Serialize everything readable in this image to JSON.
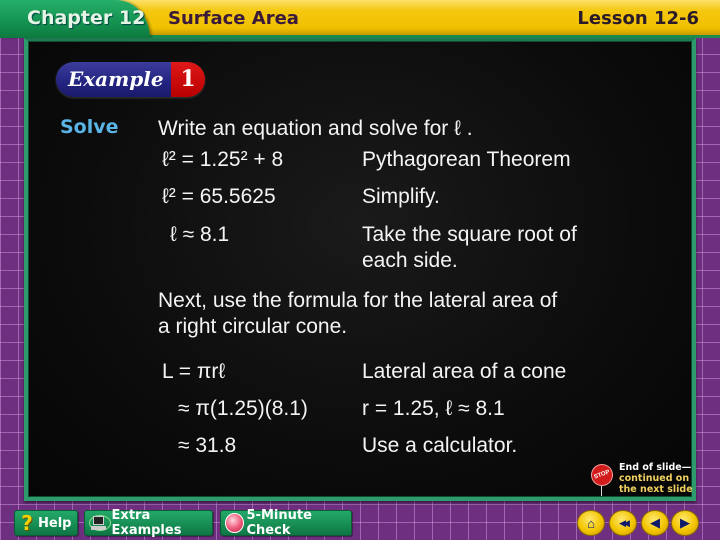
{
  "header": {
    "chapter": "Chapter 12",
    "section_title": "Surface Area",
    "lesson": "Lesson 12-6"
  },
  "badge": {
    "label": "Example",
    "number": "1"
  },
  "solve_label": "Solve",
  "intro": "Write an equation and solve for ℓ .",
  "step1": [
    {
      "math": "ℓ² = 1.25² + 8",
      "note": "Pythagorean Theorem"
    },
    {
      "math": "ℓ² = 65.5625",
      "note": "Simplify."
    },
    {
      "math": "ℓ ≈ 8.1",
      "note_line1": "Take the square root of",
      "note_line2": "each side."
    }
  ],
  "next": {
    "line1": "Next, use the formula for the lateral area of",
    "line2": "a right circular cone."
  },
  "step2": [
    {
      "math": "L = πrℓ",
      "note": "Lateral area of a cone"
    },
    {
      "math": "≈ π(1.25)(8.1)",
      "note": "r = 1.25, ℓ ≈ 8.1"
    },
    {
      "math": "≈ 31.8",
      "note": "Use a calculator."
    }
  ],
  "end_note": {
    "icon": "stop-sign-icon",
    "stop_text": "STOP",
    "line1": "End of slide—",
    "line2": "continued on",
    "line3": "the next slide"
  },
  "toolbar": {
    "help": "Help",
    "extra_examples": "Extra Examples",
    "five_minute_check": "5-Minute Check"
  },
  "nav_icons": {
    "home": "⌂",
    "first": "◀◀",
    "prev": "◀",
    "next": "▶"
  }
}
